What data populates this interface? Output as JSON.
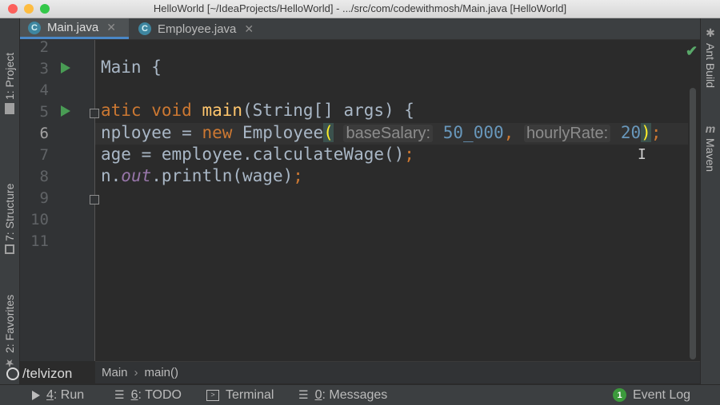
{
  "window": {
    "title": "HelloWorld [~/IdeaProjects/HelloWorld] - .../src/com/codewithmosh/Main.java [HelloWorld]"
  },
  "tabs": [
    {
      "label": "Main.java",
      "active": true,
      "close": "✕"
    },
    {
      "label": "Employee.java",
      "active": false,
      "close": "✕"
    }
  ],
  "left_tools": {
    "project": "1: Project",
    "structure": "7: Structure",
    "favorites": "2: Favorites"
  },
  "right_tools": {
    "ant": "Ant Build",
    "maven": "Maven"
  },
  "editor": {
    "line_numbers": [
      "2",
      "3",
      "4",
      "5",
      "6",
      "7",
      "8",
      "9",
      "10",
      "11"
    ],
    "current_line": "6",
    "lines": {
      "l3": {
        "t1": "Main {"
      },
      "l5": {
        "t1": "atic void ",
        "fn": "main",
        "t2": "(String[] args) {"
      },
      "l6": {
        "t1": "nployee = ",
        "kw": "new",
        "t2": " Employee",
        "paren_open": "(",
        "hint1": "baseSalary:",
        "v1": "50_000",
        "comma": ",",
        "hint2": "hourlyRate:",
        "v2": "20",
        "paren_close": ")",
        "semi": ";"
      },
      "l7": {
        "t1": "age = employee.calculateWage()",
        "semi": ";"
      },
      "l8": {
        "t1": "n.",
        "it": "out",
        "t2": ".println(wage)",
        "semi": ";"
      }
    }
  },
  "breadcrumbs": {
    "class": "Main",
    "sep": "›",
    "method": "main()"
  },
  "watermark": "/telvizon",
  "bottom": {
    "run_num": "4",
    "run_label": ": Run",
    "todo_num": "6",
    "todo_label": ": TODO",
    "terminal": "Terminal",
    "messages_num": "0",
    "messages_label": ": Messages",
    "event_count": "1",
    "event_log": "Event Log"
  },
  "colors": {
    "accent": "#4a88c7",
    "run_green": "#499c54",
    "keyword": "#cc7832",
    "function": "#ffc66d",
    "number": "#6897bb"
  }
}
